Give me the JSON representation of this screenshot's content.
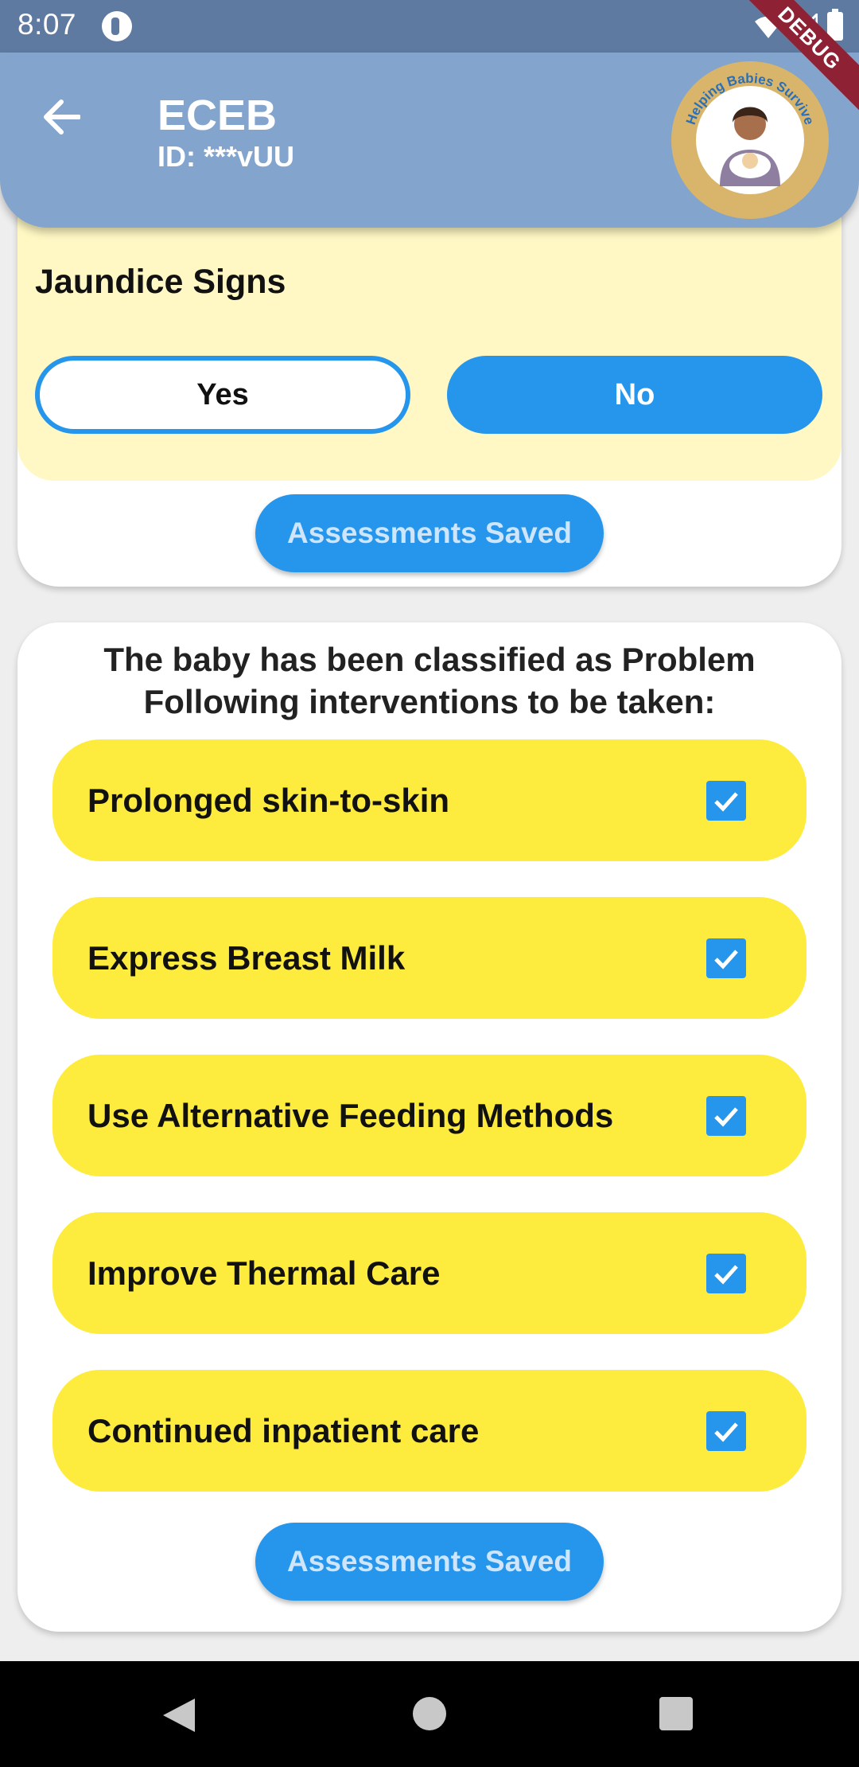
{
  "status_bar": {
    "time": "8:07"
  },
  "app_bar": {
    "title": "ECEB",
    "subtitle": "ID: ***vUU",
    "logo_text": "Helping Babies Survive"
  },
  "debug_label": "DEBUG",
  "jaundice": {
    "title": "Jaundice Signs",
    "yes_label": "Yes",
    "no_label": "No",
    "selected": "No"
  },
  "save_button_top": "Assessments Saved",
  "classification": {
    "line1": "The baby has been classified as Problem",
    "line2": "Following interventions to be taken:"
  },
  "interventions": [
    {
      "label": "Prolonged skin-to-skin",
      "checked": true
    },
    {
      "label": "Express Breast Milk",
      "checked": true
    },
    {
      "label": "Use Alternative Feeding Methods",
      "checked": true
    },
    {
      "label": "Improve Thermal Care",
      "checked": true
    },
    {
      "label": "Continued inpatient care",
      "checked": true
    }
  ],
  "save_button_bottom": "Assessments Saved",
  "colors": {
    "accent": "#2596ec",
    "app_bar": "#83a4cc",
    "status_bar": "#5f7aa0",
    "intervention_bg": "#fdeb3d",
    "jaundice_bg": "#fff8c4"
  }
}
